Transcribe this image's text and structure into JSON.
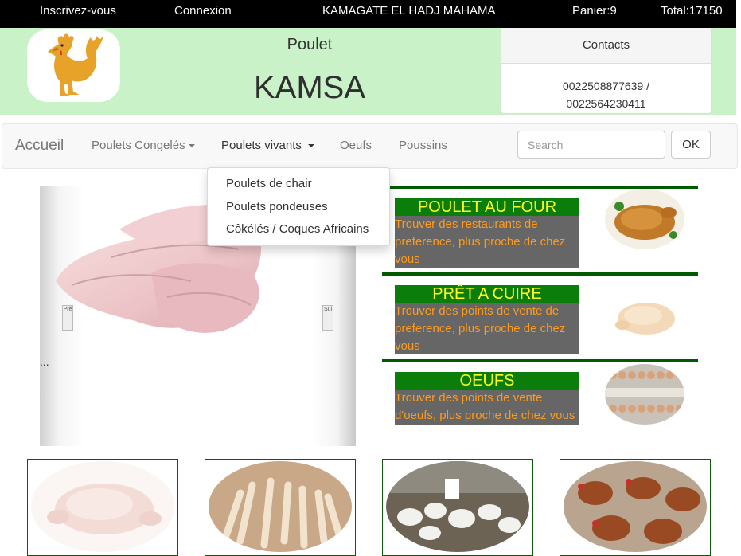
{
  "topbar": {
    "signup": "Inscrivez-vous",
    "login": "Connexion",
    "user": "KAMAGATE EL HADJ MAHAMA",
    "cart": "Panier:9",
    "total": "Total:17150"
  },
  "header": {
    "subtitle": "Poulet",
    "title": "KAMSA",
    "contacts_title": "Contacts",
    "phone1": "0022508877639 /",
    "phone2": "0022564230411"
  },
  "nav": {
    "brand": "Accueil",
    "items": [
      {
        "label": "Poulets Congelés"
      },
      {
        "label": "Poulets vivants"
      },
      {
        "label": "Oeufs"
      },
      {
        "label": "Poussins"
      }
    ],
    "search_placeholder": "Search",
    "ok_label": "OK"
  },
  "dropdown": {
    "items": [
      {
        "label": "Poulets de chair"
      },
      {
        "label": "Poulets pondeuses"
      },
      {
        "label": "Côkélés / Coques Africains"
      }
    ]
  },
  "carousel": {
    "ellipsis": "...",
    "prev_label": "Pré",
    "next_label": "Sui"
  },
  "features": [
    {
      "title": "POULET AU FOUR",
      "desc": "Trouver des restaurants de preference, plus proche de chez vous"
    },
    {
      "title": "PRÊT A CUIRE",
      "desc": "Trouver des points de vente de preference, plus proche de chez vous"
    },
    {
      "title": "OEUFS",
      "desc": "Trouver des points de vente d'oeufs, plus proche de chez vous"
    }
  ],
  "colors": {
    "topbar_bg": "#000000",
    "header_bg": "#c9f2c9",
    "feature_title_bg": "#0a7d0a",
    "feature_title_text": "#ffff22",
    "feature_desc_bg": "#666666",
    "feature_desc_text": "#ff9a1a"
  }
}
